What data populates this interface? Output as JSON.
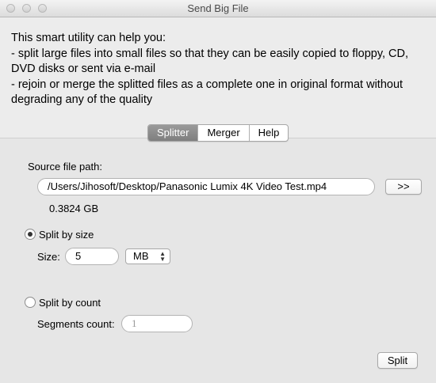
{
  "window": {
    "title": "Send Big File"
  },
  "intro": {
    "text": "This smart utility can help you:\n- split large files into small files so that they can be easily copied to floppy, CD, DVD disks or sent via e-mail\n- rejoin or merge the splitted files as a complete one in original format without degrading any of the quality"
  },
  "tabs": [
    {
      "label": "Splitter",
      "active": true
    },
    {
      "label": "Merger",
      "active": false
    },
    {
      "label": "Help",
      "active": false
    }
  ],
  "source": {
    "label": "Source file path:",
    "path": "/Users/Jihosoft/Desktop/Panasonic Lumix 4K Video Test.mp4",
    "browse_label": ">>",
    "file_size": "0.3824 GB"
  },
  "split_by_size": {
    "label": "Split by size",
    "selected": true,
    "size_label": "Size:",
    "size_value": "5",
    "unit": "MB"
  },
  "split_by_count": {
    "label": "Split by count",
    "selected": false,
    "segments_label": "Segments count:",
    "segments_placeholder": "1"
  },
  "actions": {
    "split_label": "Split"
  }
}
